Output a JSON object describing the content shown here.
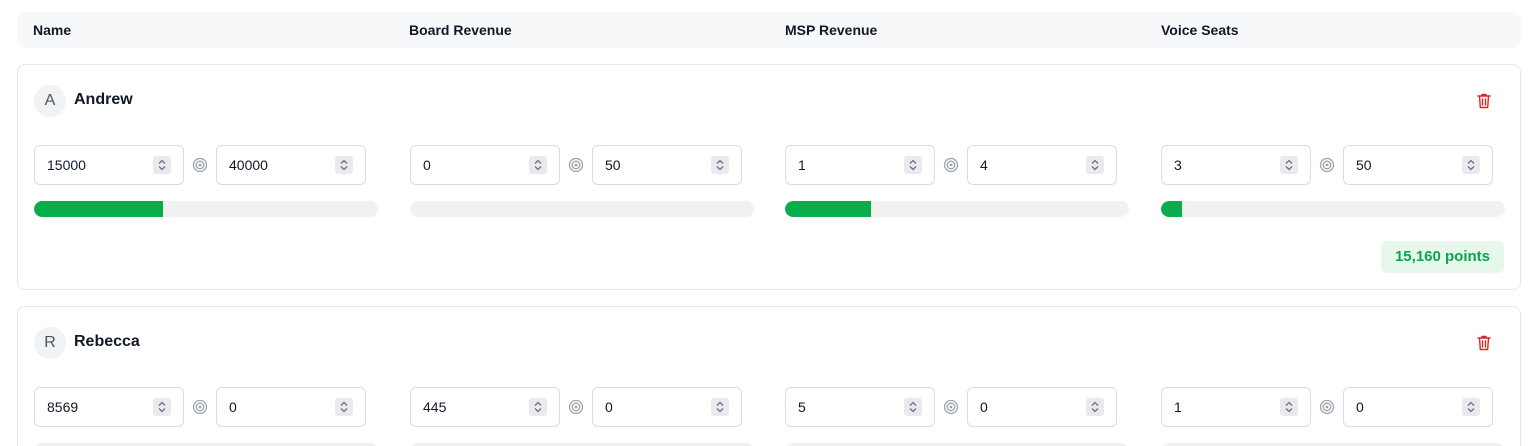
{
  "header": {
    "columns": [
      "Name",
      "Board Revenue",
      "MSP Revenue",
      "Voice Seats"
    ]
  },
  "colors": {
    "progress_fill": "#0aac4b",
    "progress_track": "#f1f1f2",
    "points_text": "#0ba64b",
    "points_bg": "#e7f7ec",
    "delete_icon": "#dc2626"
  },
  "people": [
    {
      "initial": "A",
      "name": "Andrew",
      "metrics": [
        {
          "actual": "15000",
          "target": "40000",
          "progress": 0.375
        },
        {
          "actual": "0",
          "target": "50",
          "progress": 0
        },
        {
          "actual": "1",
          "target": "4",
          "progress": 0.25
        },
        {
          "actual": "3",
          "target": "50",
          "progress": 0.06
        }
      ],
      "points": "15,160 points"
    },
    {
      "initial": "R",
      "name": "Rebecca",
      "metrics": [
        {
          "actual": "8569",
          "target": "0"
        },
        {
          "actual": "445",
          "target": "0"
        },
        {
          "actual": "5",
          "target": "0"
        },
        {
          "actual": "1",
          "target": "0"
        }
      ]
    }
  ]
}
